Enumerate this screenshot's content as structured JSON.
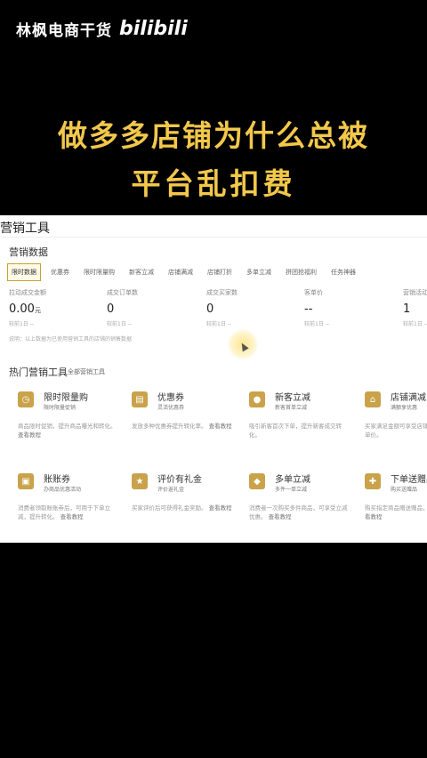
{
  "header": {
    "brand_text": "林枫电商干货",
    "brand_logo": "bilibili"
  },
  "headline": {
    "line1": "做多多店铺为什么总被",
    "line2": "平台乱扣费"
  },
  "panel": {
    "title": "营销工具",
    "section_title": "营销数据",
    "tabs": [
      {
        "label": "限时数据"
      },
      {
        "label": "优惠券"
      },
      {
        "label": "限时限量购"
      },
      {
        "label": "新客立减"
      },
      {
        "label": "店铺满减"
      },
      {
        "label": "店铺打折"
      },
      {
        "label": "多单立减"
      },
      {
        "label": "拼团抢福利"
      },
      {
        "label": "任务神器"
      }
    ],
    "metrics": [
      {
        "label": "拉动成交金额",
        "value": "0.00",
        "unit": "元",
        "compare": "较前1日 --"
      },
      {
        "label": "成交订单数",
        "value": "0",
        "unit": "",
        "compare": "较前1日 --"
      },
      {
        "label": "成交买家数",
        "value": "0",
        "unit": "",
        "compare": "较前1日 --"
      },
      {
        "label": "客单价",
        "value": "--",
        "unit": "",
        "compare": "较前1日 --"
      },
      {
        "label": "营销活动",
        "value": "1",
        "unit": "",
        "compare": "较前1日 --"
      }
    ],
    "note": "说明：以上数据为已使用营销工具的店铺的销售数据",
    "hot_title": "热门营销工具",
    "hot_link": "全部营销工具",
    "tools": [
      {
        "icon": "clock-icon",
        "name": "限时限量购",
        "tag": "限时限量促销",
        "desc": "商品限时促销，提升商品曝光和转化。",
        "link": "查看教程"
      },
      {
        "icon": "coupon-icon",
        "name": "优惠券",
        "tag": "灵活优惠券",
        "desc": "发放多种优惠券提升转化率。",
        "link": "查看教程"
      },
      {
        "icon": "new-customer-icon",
        "name": "新客立减",
        "tag": "新客首单立减",
        "desc": "吸引新客首次下单，提升新客成交转化。",
        "link": ""
      },
      {
        "icon": "store-icon",
        "name": "店铺满减",
        "tag": "满额享优惠",
        "desc": "买家满足金额可享受店铺优惠，提升客单价。",
        "link": ""
      },
      {
        "icon": "ticket-icon",
        "name": "账账券",
        "tag": "办商品优惠活动",
        "desc": "消费者领取账账券后，可用于下单立减，提升转化。",
        "link": "查看教程"
      },
      {
        "icon": "star-icon",
        "name": "评价有礼金",
        "tag": "评价返礼金",
        "desc": "买家评价后可获得礼金奖励。",
        "link": "查看教程"
      },
      {
        "icon": "bag-icon",
        "name": "多单立减",
        "tag": "多件一单立减",
        "desc": "消费者一次购买多件商品，可享受立减优惠。",
        "link": "查看教程"
      },
      {
        "icon": "gift-icon",
        "name": "下单送赠品",
        "tag": "购买送赠品",
        "desc": "购买指定商品赠送赠品，提升转化。",
        "link": "查看教程"
      }
    ]
  },
  "colors": {
    "headline": "#f3c84b",
    "accent": "#c9a227",
    "background": "#000000"
  }
}
